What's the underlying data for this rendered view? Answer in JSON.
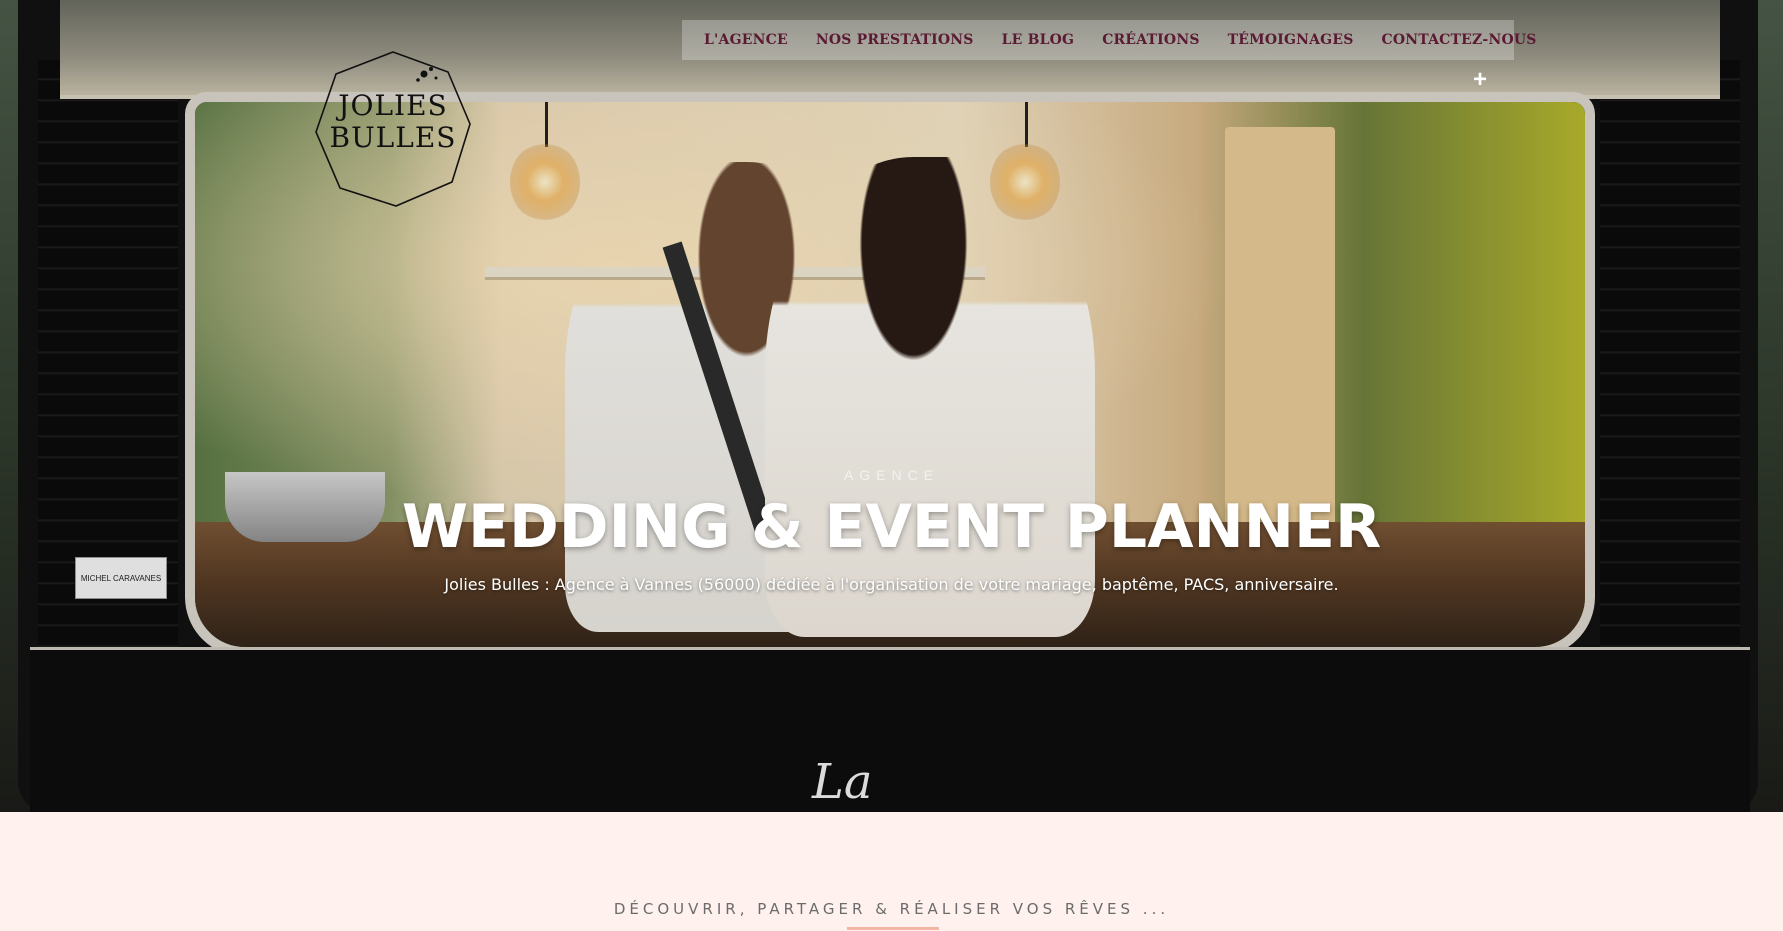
{
  "nav": {
    "items": [
      "L'AGENCE",
      "NOS PRESTATIONS",
      "LE BLOG",
      "CRÉATIONS",
      "TÉMOIGNAGES",
      "CONTACTEZ-NOUS"
    ],
    "plus_label": "+"
  },
  "logo": {
    "line1": "JOLIES",
    "line2": "BULLES"
  },
  "hero": {
    "eyebrow": "AGENCE",
    "title": "WEDDING & EVENT PLANNER",
    "subtitle": "Jolies Bulles : Agence à Vannes (56000) dédiée à l'organisation de votre mariage, baptême, PACS, anniversaire.",
    "plate_text": "MICHEL CARAVANES",
    "script_mark": "La"
  },
  "section": {
    "title": "DÉCOUVRIR, PARTAGER & RÉALISER VOS RÊVES ..."
  },
  "colors": {
    "nav_text": "#5a1a33",
    "section_bg": "#fff2ee",
    "accent_underline": "#f3b6a5"
  }
}
